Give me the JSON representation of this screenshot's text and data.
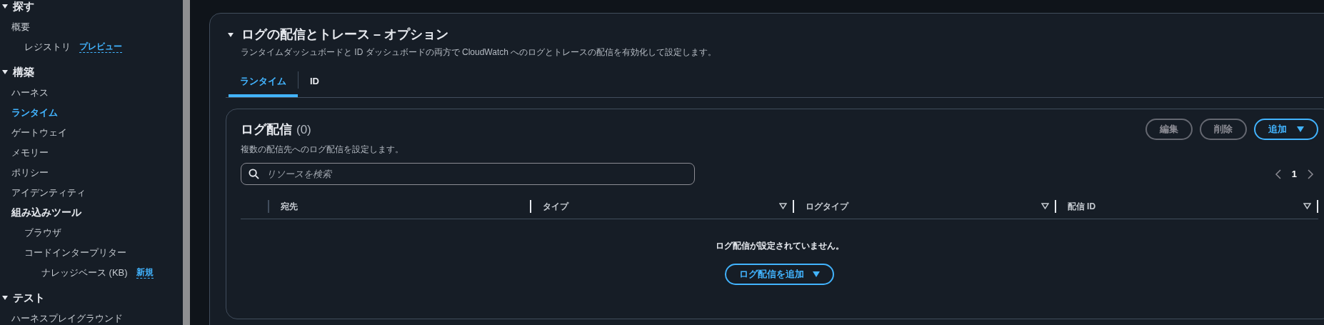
{
  "sidebar": {
    "sections": [
      {
        "label": "探す",
        "expanded": true,
        "items": [
          {
            "label": "概要",
            "kind": "link",
            "selected": false,
            "children": [
              {
                "label": "レジストリ",
                "kind": "link",
                "selected": false,
                "badge": "プレビュー"
              }
            ]
          }
        ]
      },
      {
        "label": "構築",
        "expanded": true,
        "items": [
          {
            "label": "ハーネス",
            "kind": "link",
            "selected": false
          },
          {
            "label": "ランタイム",
            "kind": "link",
            "selected": true
          },
          {
            "label": "ゲートウェイ",
            "kind": "link",
            "selected": false
          },
          {
            "label": "メモリー",
            "kind": "link",
            "selected": false
          },
          {
            "label": "ポリシー",
            "kind": "link",
            "selected": false
          },
          {
            "label": "アイデンティティ",
            "kind": "link",
            "selected": false
          },
          {
            "label": "組み込みツール",
            "kind": "group",
            "selected": false,
            "children": [
              {
                "label": "ブラウザ",
                "kind": "link",
                "selected": false
              },
              {
                "label": "コードインタープリター",
                "kind": "link",
                "selected": false,
                "children": [
                  {
                    "label": "ナレッジベース (KB)",
                    "kind": "link",
                    "selected": false,
                    "badge": "新規"
                  }
                ]
              }
            ]
          }
        ]
      },
      {
        "label": "テスト",
        "expanded": true,
        "items": [
          {
            "label": "ハーネスプレイグラウンド",
            "kind": "link",
            "selected": false
          }
        ]
      }
    ]
  },
  "panel": {
    "title": "ログの配信とトレース – オプション",
    "expanded": true,
    "description": "ランタイムダッシュボードと ID ダッシュボードの両方で CloudWatch へのログとトレースの配信を有効化して設定します。",
    "tabs": [
      {
        "label": "ランタイム",
        "selected": true
      },
      {
        "label": "ID",
        "selected": false
      }
    ],
    "card": {
      "title": "ログ配信",
      "count": "(0)",
      "description": "複数の配信先へのログ配信を設定します。",
      "buttons": [
        {
          "label": "編集",
          "kind": "normal",
          "disabled": true
        },
        {
          "label": "削除",
          "kind": "normal",
          "disabled": true
        },
        {
          "label": "追加",
          "kind": "dropdown",
          "disabled": false
        }
      ],
      "search": {
        "placeholder": "リソースを検索"
      },
      "pagination": {
        "pages": [
          {
            "label": "1",
            "selected": true
          }
        ]
      },
      "columns": [
        {
          "label": "宛先",
          "sortable": false
        },
        {
          "label": "タイプ",
          "sortable": true
        },
        {
          "label": "ログタイプ",
          "sortable": true
        },
        {
          "label": "配信 ID",
          "sortable": true
        }
      ],
      "empty": {
        "message": "ログ配信が設定されていません。",
        "button": "ログ配信を追加"
      }
    }
  }
}
